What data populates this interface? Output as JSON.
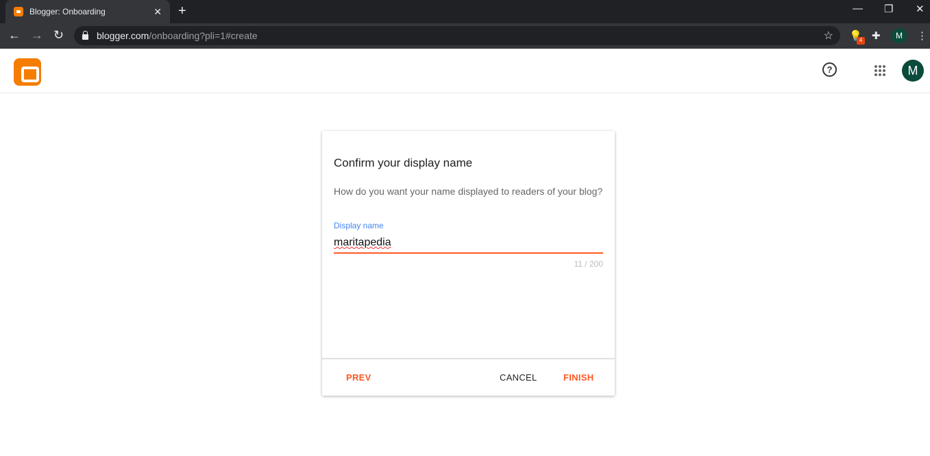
{
  "browser": {
    "tab_title": "Blogger: Onboarding",
    "url_host": "blogger.com",
    "url_path": "/onboarding?pli=1#create",
    "extension_badge": "4",
    "profile_initial": "M"
  },
  "header": {
    "avatar_initial": "M"
  },
  "dialog": {
    "title": "Confirm your display name",
    "subtitle": "How do you want your name displayed to readers of your blog?",
    "field_label": "Display name",
    "field_value": "maritapedia",
    "char_count": "11 / 200",
    "prev": "PREV",
    "cancel": "CANCEL",
    "finish": "FINISH"
  },
  "colors": {
    "accent": "#ff5722",
    "label_blue": "#4285f4",
    "brand": "#f57d00"
  }
}
